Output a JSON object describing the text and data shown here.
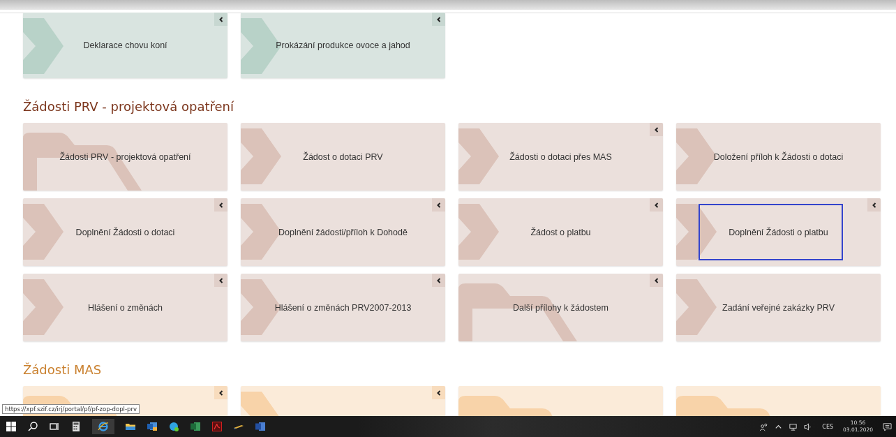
{
  "sections": [
    {
      "color": "#d9e4e0",
      "tiles": [
        {
          "label": "Deklarace chovu koní",
          "kind": "chevron",
          "toggle": true,
          "selected": false
        },
        {
          "label": "Prokázání produkce ovoce a jahod",
          "kind": "chevron",
          "toggle": true,
          "selected": false
        }
      ]
    },
    {
      "heading": "Žádosti PRV - projektová opatření",
      "color": "#ebe0dc",
      "tiles": [
        {
          "label": "Žádosti PRV - projektová opatření",
          "kind": "folder",
          "toggle": false,
          "selected": false
        },
        {
          "label": "Žádost o dotaci PRV",
          "kind": "chevron",
          "toggle": false,
          "selected": false
        },
        {
          "label": "Žádosti o dotaci přes MAS",
          "kind": "chevron",
          "toggle": true,
          "selected": false
        },
        {
          "label": "Doložení příloh k Žádosti o dotaci",
          "kind": "chevron",
          "toggle": false,
          "selected": false
        },
        {
          "label": "Doplnění Žádosti o dotaci",
          "kind": "chevron",
          "toggle": true,
          "selected": false
        },
        {
          "label": "Doplnění žádosti/příloh k Dohodě",
          "kind": "chevron",
          "toggle": true,
          "selected": false
        },
        {
          "label": "Žádost o platbu",
          "kind": "chevron",
          "toggle": true,
          "selected": false
        },
        {
          "label": "Doplnění Žádosti o platbu",
          "kind": "chevron",
          "toggle": true,
          "selected": true
        },
        {
          "label": "Hlášení o změnách",
          "kind": "chevron",
          "toggle": true,
          "selected": false
        },
        {
          "label": "Hlášení o změnách PRV2007-2013",
          "kind": "chevron",
          "toggle": true,
          "selected": false
        },
        {
          "label": "Další přílohy k žádostem",
          "kind": "folder",
          "toggle": true,
          "selected": false
        },
        {
          "label": "Zadání veřejné zakázky PRV",
          "kind": "chevron",
          "toggle": false,
          "selected": false
        }
      ]
    },
    {
      "heading": "Žádosti MAS",
      "color": "#fbebd9",
      "tiles": [
        {
          "kind": "folder",
          "toggle": true,
          "selected": false
        },
        {
          "kind": "chevron",
          "toggle": true,
          "selected": false
        },
        {
          "kind": "folder",
          "toggle": false,
          "selected": false
        },
        {
          "kind": "folder",
          "toggle": false,
          "selected": false
        }
      ]
    }
  ],
  "status_url": "https://xpf.szif.cz/irj/portal/pf/pf-zop-dopl-prv",
  "taskbar": {
    "language": "CES",
    "time": "10:56",
    "date": "03.01.2020"
  }
}
